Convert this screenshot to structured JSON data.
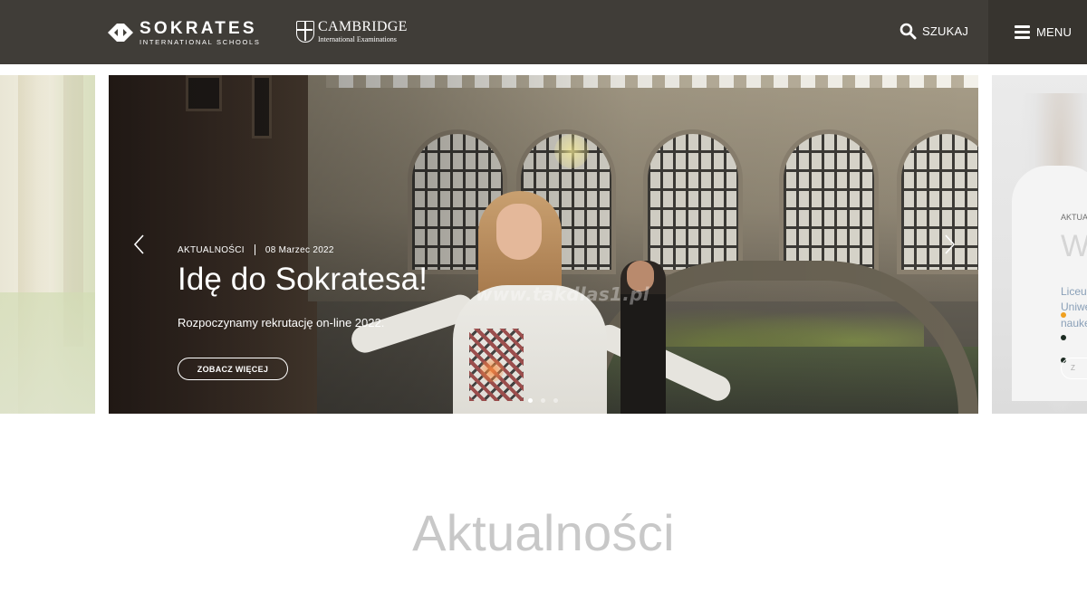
{
  "header": {
    "logo": {
      "name": "SOKRATES",
      "tagline": "INTERNATIONAL SCHOOLS"
    },
    "partner_logo": {
      "name": "CAMBRIDGE",
      "tagline": "International Examinations"
    },
    "search_label": "SZUKAJ",
    "menu_label": "MENU",
    "background_color": "#403d38"
  },
  "slider": {
    "active_slide": {
      "category": "AKTUALNOŚCI",
      "date": "08 Marzec 2022",
      "title": "Idę do Sokratesa!",
      "text": "Rozpoczynamy rekrutację on-line 2022.",
      "button_label": "ZOBACZ WIĘCEJ",
      "watermark": "www.takdlas1.pl"
    },
    "next_slide_preview": {
      "category": "AKTUALNOŚCI",
      "title_fragment": "W",
      "text_fragment": "Liceu\nUniwe\nnauke",
      "button_fragment": "Z"
    },
    "dot_count": 3,
    "active_dot": 0,
    "prev_icon": "chevron-left-icon",
    "next_icon": "chevron-right-icon"
  },
  "sections": {
    "news_title": "Aktualności"
  }
}
